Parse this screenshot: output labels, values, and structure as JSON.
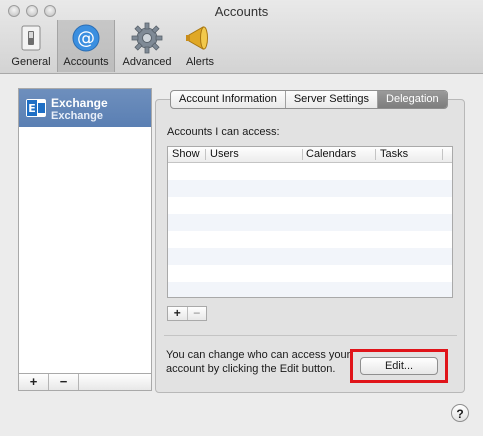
{
  "window": {
    "title": "Accounts"
  },
  "toolbar": {
    "items": [
      {
        "label": "General",
        "icon": "switch-icon",
        "selected": false
      },
      {
        "label": "Accounts",
        "icon": "at-sign-icon",
        "selected": true
      },
      {
        "label": "Advanced",
        "icon": "gear-icon",
        "selected": false
      },
      {
        "label": "Alerts",
        "icon": "megaphone-icon",
        "selected": false
      }
    ]
  },
  "sidebar": {
    "accounts": [
      {
        "name": "Exchange",
        "type": "Exchange",
        "icon": "exchange-icon",
        "selected": true
      }
    ],
    "add_label": "+",
    "remove_label": "−"
  },
  "tabs": [
    {
      "label": "Account Information",
      "active": false
    },
    {
      "label": "Server Settings",
      "active": false
    },
    {
      "label": "Delegation",
      "active": true
    }
  ],
  "delegation": {
    "accounts_label": "Accounts I can access:",
    "columns": [
      "Show",
      "Users",
      "Calendars",
      "Tasks"
    ],
    "rows": [],
    "add_label": "+",
    "remove_label": "−",
    "help_text": "You can change who can access your account by clicking the Edit button.",
    "edit_label": "Edit..."
  },
  "help": {
    "label": "?"
  },
  "colors": {
    "selection": "#5a7fb3",
    "highlight": "#e0141a",
    "exchange_blue": "#1f6fc5"
  }
}
